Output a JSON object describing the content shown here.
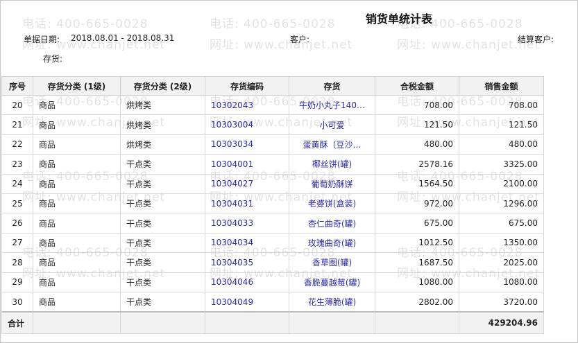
{
  "report": {
    "title": "销货单统计表",
    "date_label": "单据日期:",
    "date_value": "2018.08.01 - 2018.08.31",
    "customer_label": "客户:",
    "settle_label": "结算客户:",
    "inventory_label": "存货:"
  },
  "watermark": {
    "phone": "电话: 400-665-0028",
    "site": "网址: www.chanjet.net"
  },
  "columns": [
    "序号",
    "存货分类 (1级)",
    "存货分类 (2级)",
    "存货编码",
    "存货",
    "合税金额",
    "销售金额"
  ],
  "rows": [
    {
      "no": "20",
      "cat1": "商品",
      "cat2": "烘烤类",
      "code": "10302043",
      "item": "牛奶小丸子140…",
      "tax": "708.00",
      "sales": "708.00"
    },
    {
      "no": "21",
      "cat1": "商品",
      "cat2": "烘烤类",
      "code": "10303004",
      "item": "小可爱",
      "tax": "121.50",
      "sales": "121.50"
    },
    {
      "no": "22",
      "cat1": "商品",
      "cat2": "烘烤类",
      "code": "10303034",
      "item": "蛋黄酥（豆沙…",
      "tax": "480.00",
      "sales": "480.00"
    },
    {
      "no": "23",
      "cat1": "商品",
      "cat2": "干点类",
      "code": "10304001",
      "item": "椰丝饼(罐)",
      "tax": "2578.16",
      "sales": "3325.00"
    },
    {
      "no": "24",
      "cat1": "商品",
      "cat2": "干点类",
      "code": "10304027",
      "item": "葡萄奶酥饼",
      "tax": "1564.50",
      "sales": "2100.00"
    },
    {
      "no": "25",
      "cat1": "商品",
      "cat2": "干点类",
      "code": "10304031",
      "item": "老婆饼(盒装)",
      "tax": "972.00",
      "sales": "1296.00"
    },
    {
      "no": "26",
      "cat1": "商品",
      "cat2": "干点类",
      "code": "10304033",
      "item": "杏仁曲奇(罐)",
      "tax": "675.00",
      "sales": "675.00"
    },
    {
      "no": "27",
      "cat1": "商品",
      "cat2": "干点类",
      "code": "10304034",
      "item": "玫瑰曲奇(罐)",
      "tax": "1012.50",
      "sales": "1350.00"
    },
    {
      "no": "28",
      "cat1": "商品",
      "cat2": "干点类",
      "code": "10304035",
      "item": "香草圈(罐)",
      "tax": "1687.50",
      "sales": "2025.00"
    },
    {
      "no": "29",
      "cat1": "商品",
      "cat2": "干点类",
      "code": "10304046",
      "item": "香脆蔓越莓(罐)",
      "tax": "1080.00",
      "sales": "1080.00"
    },
    {
      "no": "30",
      "cat1": "商品",
      "cat2": "干点类",
      "code": "10304049",
      "item": "花生薄脆(罐)",
      "tax": "2802.00",
      "sales": "3720.00"
    }
  ],
  "total": {
    "label": "合计",
    "sales": "429204.96"
  }
}
